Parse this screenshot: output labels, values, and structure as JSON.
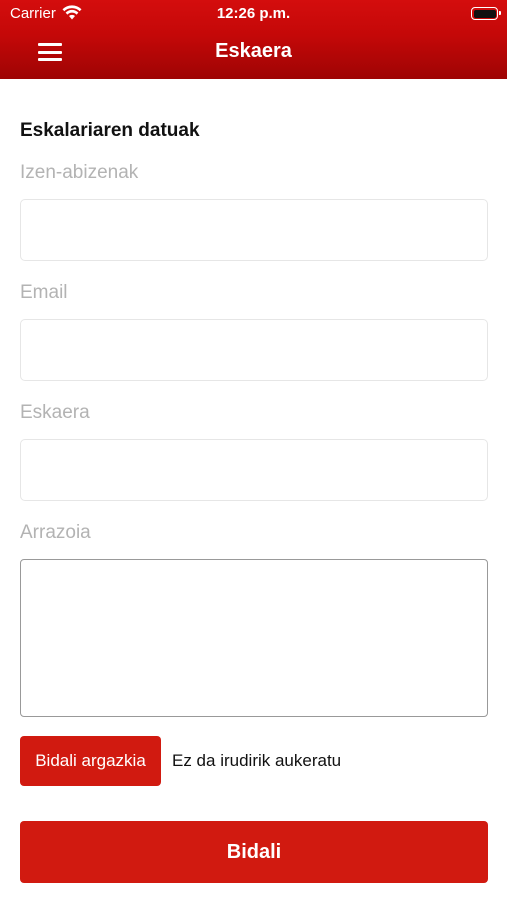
{
  "status_bar": {
    "carrier": "Carrier",
    "time": "12:26 p.m."
  },
  "nav": {
    "title": "Eskaera",
    "menu_icon": "hamburger-menu-icon"
  },
  "form": {
    "section_title": "Eskalariaren datuak",
    "fields": [
      {
        "label": "Izen-abizenak",
        "value": ""
      },
      {
        "label": "Email",
        "value": ""
      },
      {
        "label": "Eskaera",
        "value": ""
      }
    ],
    "reason": {
      "label": "Arrazoia",
      "value": ""
    },
    "photo": {
      "button_label": "Bidali argazkia",
      "status": "Ez da irudirik aukeratu"
    },
    "submit_label": "Bidali"
  },
  "colors": {
    "header": "#c40808",
    "accent": "#d11a10"
  }
}
